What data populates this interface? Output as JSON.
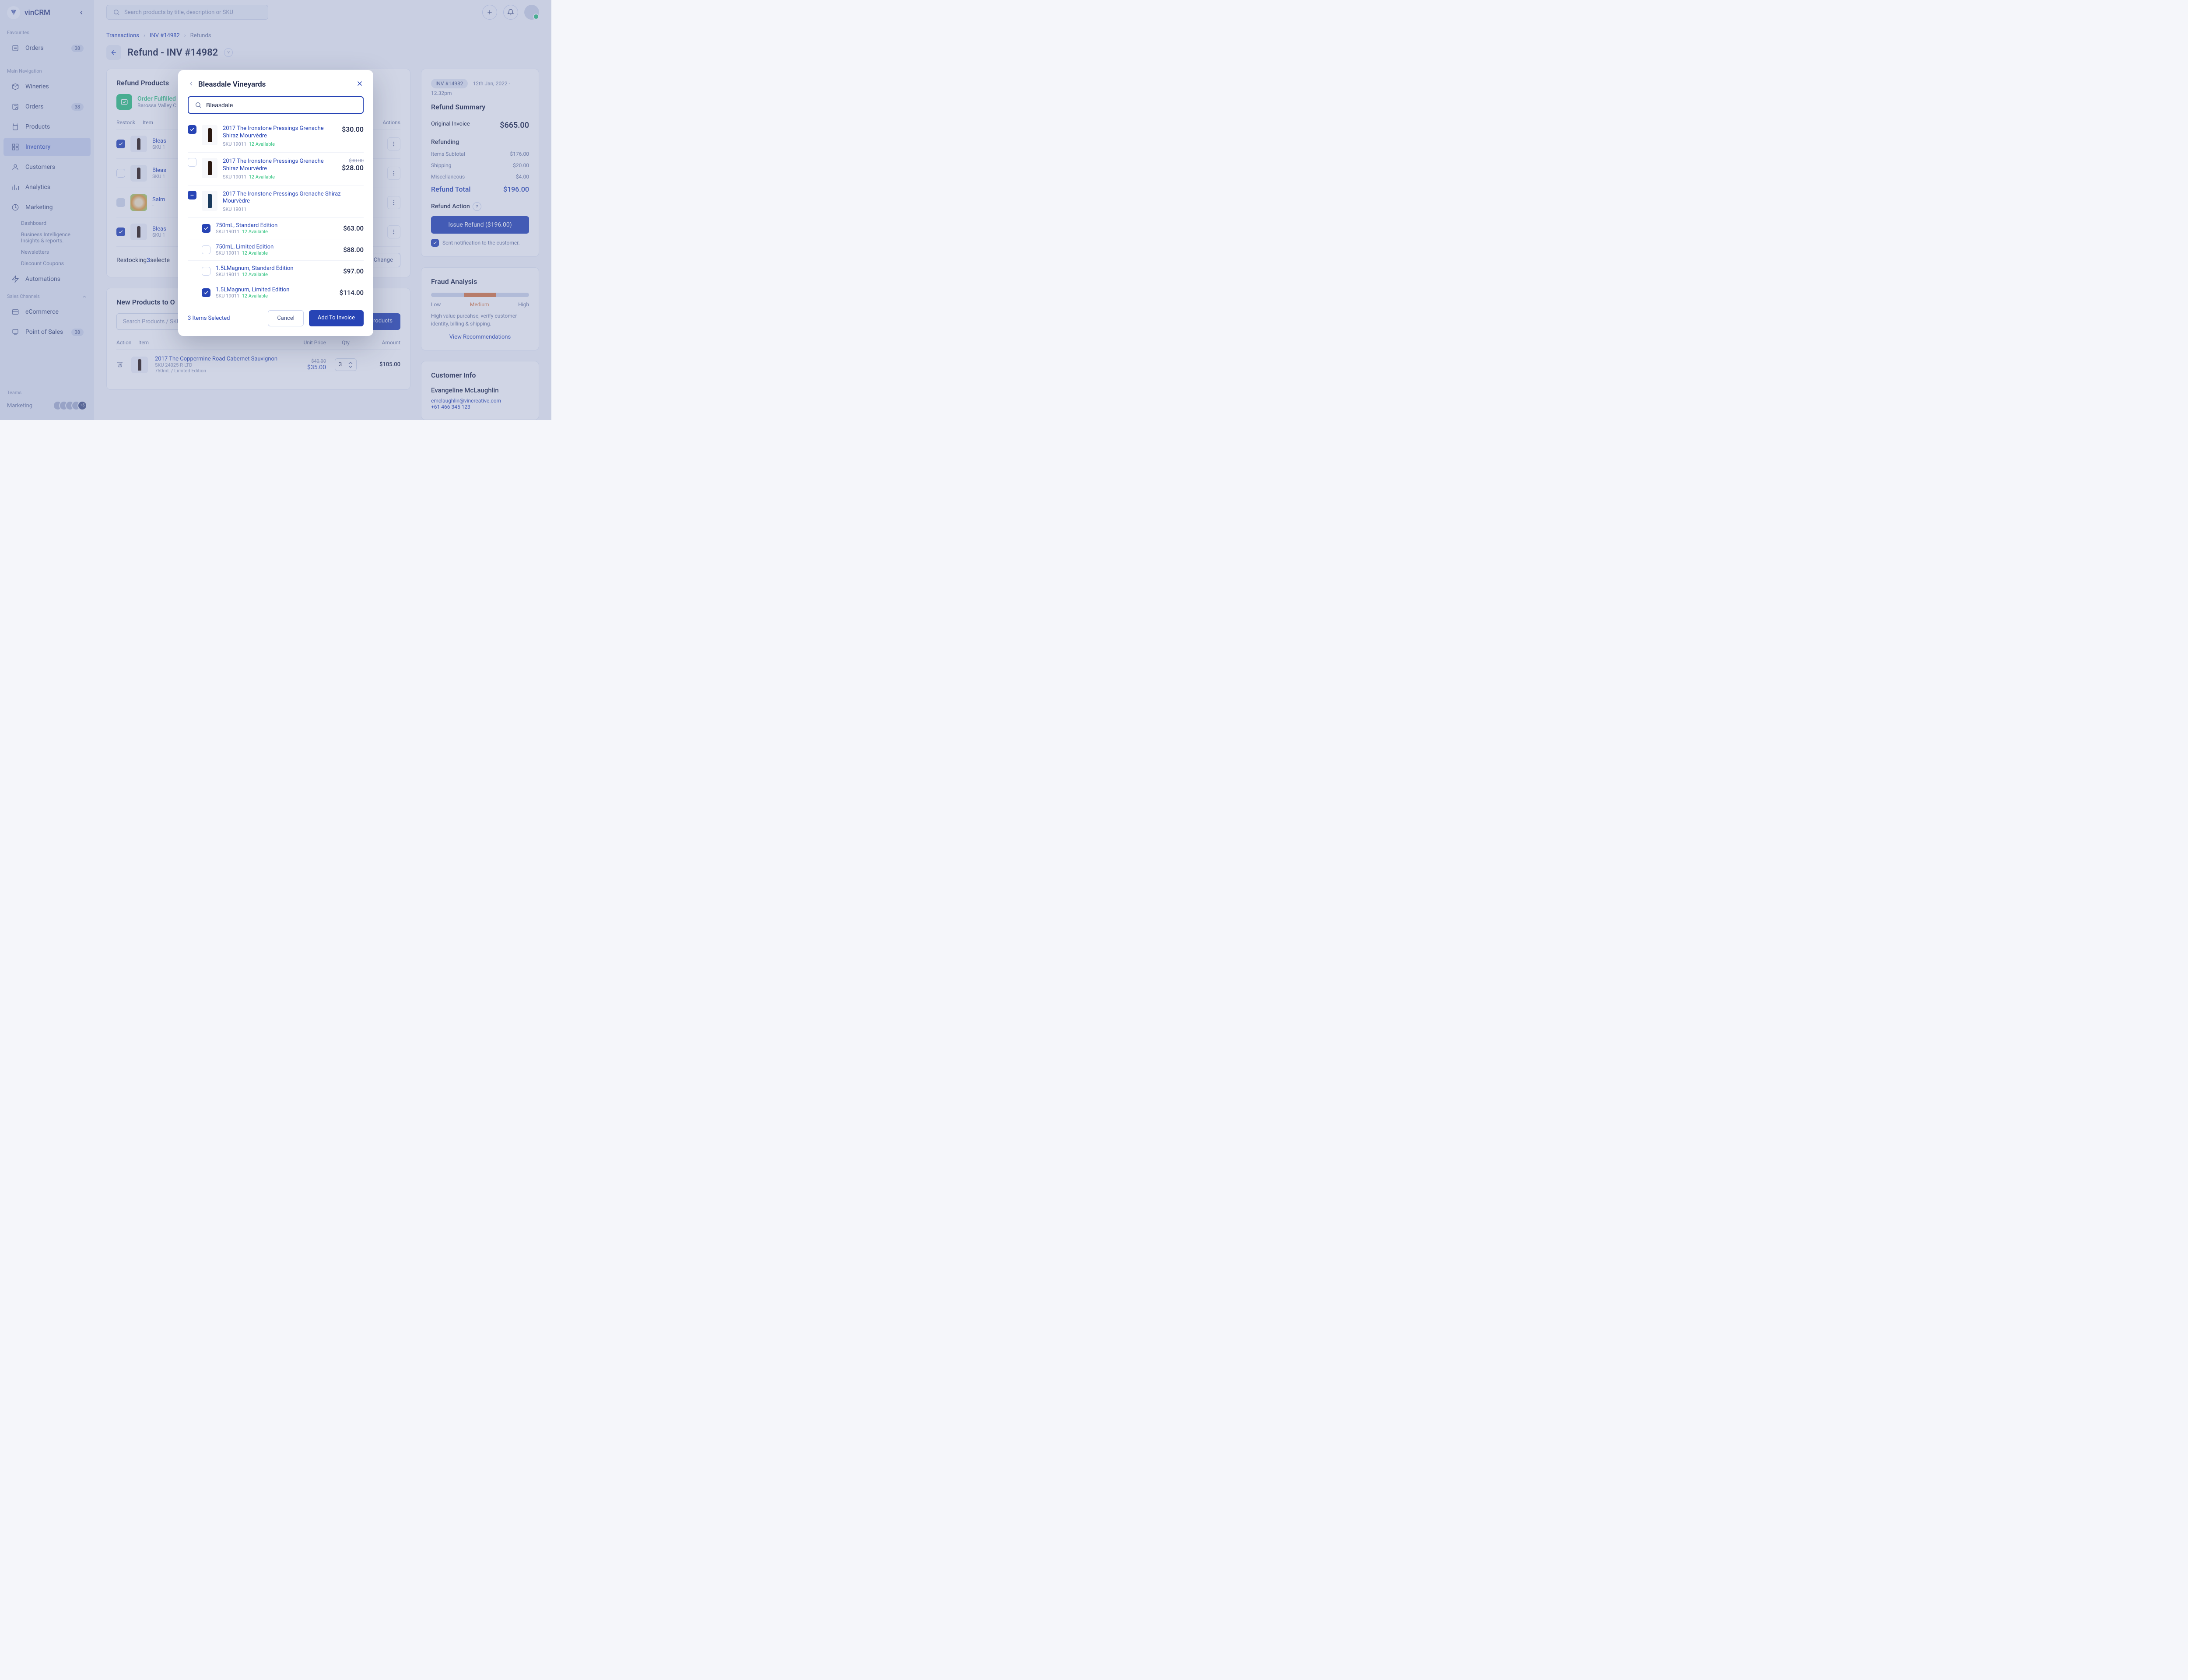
{
  "app": {
    "name": "vinCRM"
  },
  "search": {
    "placeholder": "Search products by title, description or SKU"
  },
  "sidebar": {
    "fav_label": "Favourites",
    "fav_orders": "Orders",
    "fav_orders_badge": "38",
    "main_label": "Main Navigation",
    "items": [
      {
        "label": "Wineries"
      },
      {
        "label": "Orders",
        "badge": "38"
      },
      {
        "label": "Products"
      },
      {
        "label": "Inventory"
      },
      {
        "label": "Customers"
      },
      {
        "label": "Analytics"
      },
      {
        "label": "Marketing"
      }
    ],
    "marketing_sub": [
      "Dashboard",
      "Business Intelligence Insights & reports.",
      "Newsletters",
      "Discount Coupons"
    ],
    "automations": "Automations",
    "channels_label": "Sales Channels",
    "channels": [
      {
        "label": "eCommerce"
      },
      {
        "label": "Point of Sales",
        "badge": "38"
      }
    ],
    "teams_label": "Teams",
    "teams": [
      {
        "label": "Marketing",
        "more": "+5"
      }
    ]
  },
  "breadcrumb": {
    "a": "Transactions",
    "b": "INV #14982",
    "c": "Refunds"
  },
  "page_title": "Refund - INV #14982",
  "refund_products": {
    "title": "Refund Products",
    "fulfilled": "Order Fulfilled",
    "location": "Barossa Valley C",
    "hdr_restock": "Restock",
    "hdr_item": "Item",
    "hdr_actions": "Actions",
    "rows": [
      {
        "name": "Bleas",
        "sku": "SKU 1"
      },
      {
        "name": "Bleas",
        "sku": "SKU 1"
      },
      {
        "name": "Salm",
        "sku": "-"
      },
      {
        "name": "Bleas",
        "sku": "SKU 1"
      }
    ],
    "restock_text_pre": "Restocking ",
    "restock_count": "3",
    "restock_text_post": " selecte",
    "change_btn": "Change"
  },
  "new_products": {
    "title": "New Products to O",
    "search_placeholder": "Search Products / SKU",
    "browse": "Browse Products",
    "hdr_action": "Action",
    "hdr_item": "Item",
    "hdr_unit": "Unit Price",
    "hdr_qty": "Qty",
    "hdr_amount": "Amount",
    "row": {
      "name": "2017 The Coppermine Road Cabernet Sauvignon",
      "sku": "SKU 24025-R-LTD",
      "variant": "750mL / Limited Edition",
      "orig": "$40.00",
      "price": "$35.00",
      "qty": "3",
      "amount": "$105.00"
    }
  },
  "summary": {
    "inv_badge": "INV #14982",
    "date": "12th Jan, 2022 - 12.32pm",
    "title": "Refund Summary",
    "original_label": "Original Invoice",
    "original": "$665.00",
    "refunding_label": "Refunding",
    "subtotal_label": "Items Subtotal",
    "subtotal": "$176.00",
    "shipping_label": "Shipping",
    "shipping": "$20.00",
    "misc_label": "Miscellaneous",
    "misc": "$4.00",
    "total_label": "Refund Total",
    "total": "$196.00",
    "action_label": "Refund Action",
    "issue_btn": "Issue Refund ($196.00)",
    "notify": "Sent notification to the customer."
  },
  "fraud": {
    "title": "Fraud Analysis",
    "low": "Low",
    "medium": "Medium",
    "high": "High",
    "note": "High value purcahse, verify customer identity, billing & shipping.",
    "recs": "View Recommendations"
  },
  "customer": {
    "title": "Customer Info",
    "name": "Evangeline McLaughlin",
    "email": "emclaughlin@vincreative.com",
    "phone": "+61 466 345 123"
  },
  "modal": {
    "title": "Bleasdale Vineyards",
    "search_value": "Bleasdale",
    "items": [
      {
        "checked": true,
        "name": "2017 The Ironstone Pressings Grenache Shiraz Mourvèdre",
        "sku": "SKU 19011",
        "avail": "12 Available",
        "price": "$30.00"
      },
      {
        "checked": false,
        "name": "2017 The Ironstone Pressings Grenache Shiraz Mourvèdre",
        "sku": "SKU 19011",
        "avail": "12 Available",
        "strike": "$30.00",
        "price": "$28.00"
      }
    ],
    "group": {
      "name": "2017 The Ironstone Pressings Grenache Shiraz Mourvèdre",
      "sku": "SKU 19011"
    },
    "variants": [
      {
        "checked": true,
        "name": "750mL, Standard Edition",
        "sku": "SKU 19011",
        "avail": "12 Available",
        "price": "$63.00"
      },
      {
        "checked": false,
        "name": "750mL, Limited Edition",
        "sku": "SKU 19011",
        "avail": "12 Available",
        "price": "$88.00"
      },
      {
        "checked": false,
        "name": "1.5LMagnum, Standard Edition",
        "sku": "SKU 19011",
        "avail": "12 Available",
        "price": "$97.00"
      },
      {
        "checked": true,
        "name": "1.5LMagnum, Limited Edition",
        "sku": "SKU 19011",
        "avail": "12 Available",
        "price": "$114.00"
      }
    ],
    "selected": "3 Items Selected",
    "cancel": "Cancel",
    "add": "Add To Invoice"
  }
}
